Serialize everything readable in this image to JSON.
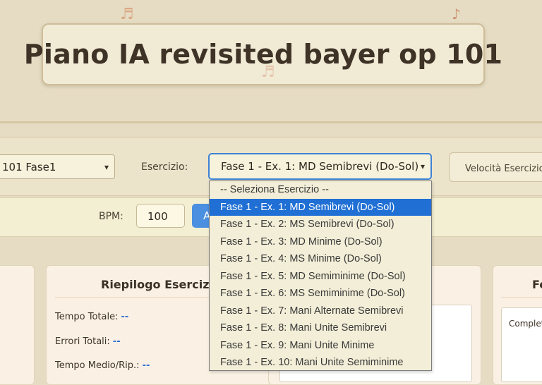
{
  "header": {
    "title": "Piano IA revisited bayer op 101"
  },
  "controls": {
    "fase_select_value": "101 Fase1",
    "esercizio_label": "Esercizio:",
    "esercizio_select_value": "Fase 1 - Ex. 1: MD Semibrevi (Do-Sol)",
    "velocita_label": "Velocità Esercizio:",
    "bpm_label": "BPM:",
    "bpm_value": "100",
    "blue_button_partial": "A"
  },
  "dropdown": {
    "options": [
      "-- Seleziona Esercizio --",
      "Fase 1 - Ex. 1: MD Semibrevi (Do-Sol)",
      "Fase 1 - Ex. 2: MS Semibrevi (Do-Sol)",
      "Fase 1 - Ex. 3: MD Minime (Do-Sol)",
      "Fase 1 - Ex. 4: MS Minime (Do-Sol)",
      "Fase 1 - Ex. 5: MD Semiminime (Do-Sol)",
      "Fase 1 - Ex. 6: MS Semiminime (Do-Sol)",
      "Fase 1 - Ex. 7: Mani Alternate Semibrevi",
      "Fase 1 - Ex. 8: Mani Unite Semibrevi",
      "Fase 1 - Ex. 9: Mani Unite Minime",
      "Fase 1 - Ex. 10: Mani Unite Semiminime"
    ],
    "selected_index": 1
  },
  "riepilogo": {
    "title": "Riepilogo Esercizio:",
    "tempo_totale_label": "Tempo Totale:",
    "tempo_totale_value": "--",
    "errori_totali_label": "Errori Totali:",
    "errori_totali_value": "--",
    "tempo_medio_label": "Tempo Medio/Rip.:",
    "tempo_medio_value": "--"
  },
  "right_panel": {
    "title_partial": "Fe",
    "text_partial": "Completa"
  },
  "decor": {
    "note_icon_1": "♬",
    "note_icon_2": "♪",
    "note_icon_3": "♬"
  },
  "colors": {
    "accent_blue": "#1f6fd4",
    "button_blue": "#4a8fe0",
    "background": "#e6dcc4",
    "value_blue": "#2f6fd6"
  }
}
